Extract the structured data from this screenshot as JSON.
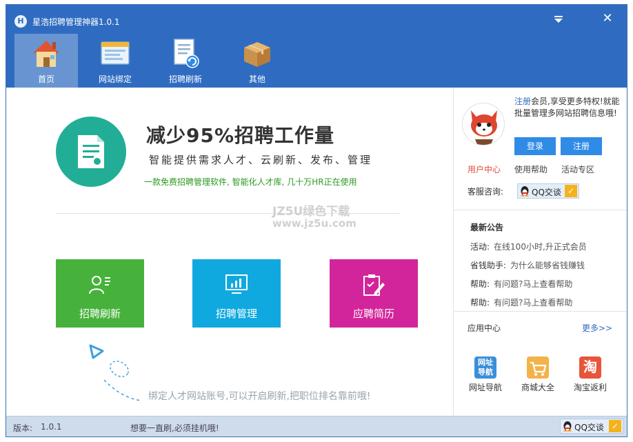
{
  "window": {
    "title": "星浩招聘管理神器1.0.1",
    "logo_letter": "H",
    "close_glyph": "✕"
  },
  "nav": [
    {
      "label": "首页",
      "icon": "house-icon",
      "active": true
    },
    {
      "label": "网站绑定",
      "icon": "window-icon",
      "active": false
    },
    {
      "label": "招聘刷新",
      "icon": "document-refresh-icon",
      "active": false
    },
    {
      "label": "其他",
      "icon": "box-icon",
      "active": false
    }
  ],
  "hero": {
    "title": "减少95%招聘工作量",
    "subtitle": "智能提供需求人才、云刷新、发布、管理",
    "desc": "一款免费招聘管理软件, 智能化人才库, 几十万HR正在使用"
  },
  "watermark": {
    "line1": "JZ5U绿色下载",
    "line2": "www.jz5u.com"
  },
  "tiles": [
    {
      "label": "招聘刷新",
      "color": "#47b23b",
      "icon": "person-list-icon"
    },
    {
      "label": "招聘管理",
      "color": "#10a9df",
      "icon": "chart-monitor-icon"
    },
    {
      "label": "应聘简历",
      "color": "#d3259b",
      "icon": "clipboard-edit-icon"
    }
  ],
  "tip": "绑定人才网站账号,可以开启刷新,把职位排名靠前哦!",
  "side": {
    "promo_register": "注册",
    "promo_rest": "会员,享受更多特权!就能批量管理多网站招聘信息哦!",
    "login_label": "登录",
    "register_label": "注册",
    "links": [
      "用户中心",
      "使用帮助",
      "活动专区"
    ],
    "service_label": "客服咨询:",
    "qq_label": "QQ交谈",
    "notice_title": "最新公告",
    "notices": [
      {
        "key": "活动:",
        "value": "在线100小时,升正式会员"
      },
      {
        "key": "省钱助手:",
        "value": "为什么能够省钱赚钱"
      },
      {
        "key": "帮助:",
        "value": "有问题?马上查看帮助"
      },
      {
        "key": "帮助:",
        "value": "有问题?马上查看帮助"
      }
    ],
    "apps_title": "应用中心",
    "apps_more": "更多>>",
    "apps": [
      {
        "label": "网址导航",
        "icon_text": "网址导航",
        "icon": "url-nav-icon"
      },
      {
        "label": "商城大全",
        "icon_text": "",
        "icon": "shopping-cart-icon"
      },
      {
        "label": "淘宝返利",
        "icon_text": "淘",
        "icon": "taobao-icon"
      }
    ]
  },
  "status": {
    "version_label": "版本:",
    "version": "1.0.1",
    "tip": "想要一直刷,必须挂机哦!",
    "qq_label": "QQ交谈"
  },
  "colors": {
    "primary": "#2f6cc1",
    "hero_circle": "#22ae96",
    "desc_green": "#2a9a1e",
    "user_center_red": "#e24a3a",
    "status_bar": "#cfdcec"
  }
}
